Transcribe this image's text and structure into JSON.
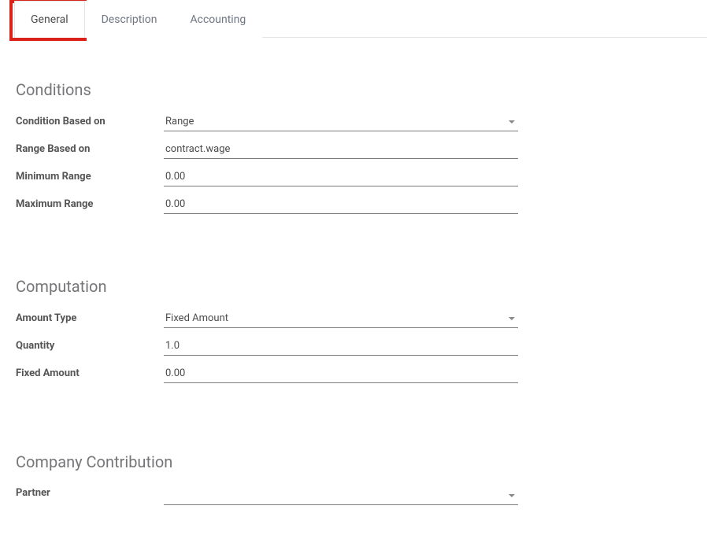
{
  "tabs": {
    "general": "General",
    "description": "Description",
    "accounting": "Accounting"
  },
  "sections": {
    "conditions": {
      "title": "Conditions",
      "fields": {
        "condition_based_on": {
          "label": "Condition Based on",
          "value": "Range"
        },
        "range_based_on": {
          "label": "Range Based on",
          "value": "contract.wage"
        },
        "minimum_range": {
          "label": "Minimum Range",
          "value": "0.00"
        },
        "maximum_range": {
          "label": "Maximum Range",
          "value": "0.00"
        }
      }
    },
    "computation": {
      "title": "Computation",
      "fields": {
        "amount_type": {
          "label": "Amount Type",
          "value": "Fixed Amount"
        },
        "quantity": {
          "label": "Quantity",
          "value": "1.0"
        },
        "fixed_amount": {
          "label": "Fixed Amount",
          "value": "0.00"
        }
      }
    },
    "company_contribution": {
      "title": "Company Contribution",
      "fields": {
        "partner": {
          "label": "Partner",
          "value": ""
        }
      }
    }
  }
}
